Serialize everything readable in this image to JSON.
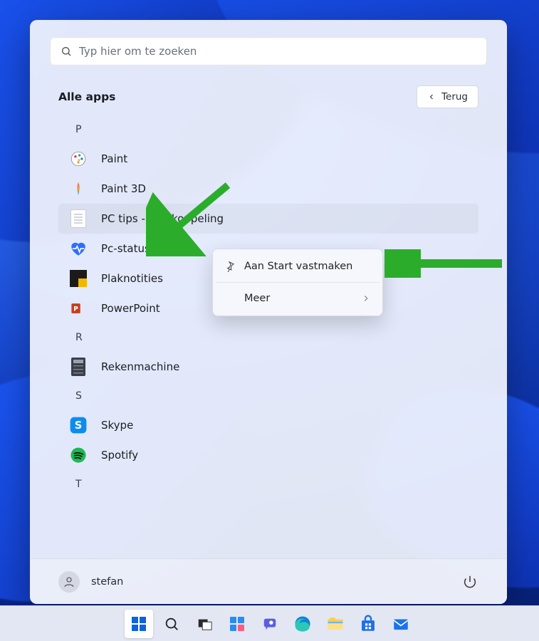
{
  "search": {
    "placeholder": "Typ hier om te zoeken"
  },
  "header": {
    "title": "Alle apps",
    "back_label": "Terug"
  },
  "letters": {
    "P": "P",
    "R": "R",
    "S": "S",
    "T": "T"
  },
  "apps": {
    "paint": "Paint",
    "paint3d": "Paint 3D",
    "pctips": "PC tips - Snelkoppeling",
    "pcstatus": "Pc-statuscontrole",
    "plaknotities": "Plaknotities",
    "powerpoint": "PowerPoint",
    "rekenmachine": "Rekenmachine",
    "skype": "Skype",
    "spotify": "Spotify"
  },
  "context_menu": {
    "pin": "Aan Start vastmaken",
    "more": "Meer"
  },
  "user": {
    "name": "stefan"
  },
  "taskbar": {
    "start": "start",
    "search": "search",
    "taskview": "taskview",
    "widgets": "widgets",
    "chat": "chat",
    "edge": "edge",
    "explorer": "explorer",
    "store": "store",
    "mail": "mail"
  },
  "colors": {
    "arrow": "#2bad2b"
  }
}
